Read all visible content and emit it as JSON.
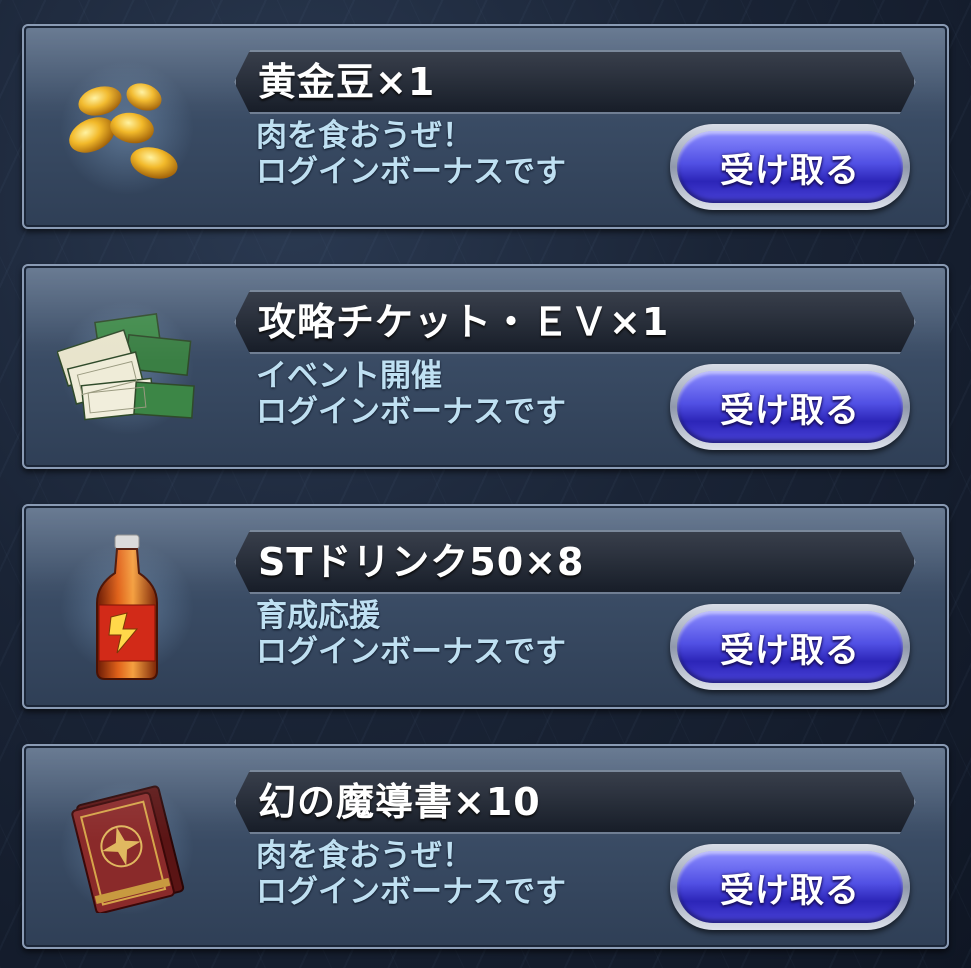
{
  "rewards": [
    {
      "title": "黄金豆×1",
      "line1": "肉を食おうぜ！",
      "line2": "ログインボーナスです",
      "button": "受け取る",
      "icon": "golden-beans-icon"
    },
    {
      "title": "攻略チケット・ＥＶ×1",
      "line1": "イベント開催",
      "line2": "ログインボーナスです",
      "button": "受け取る",
      "icon": "tickets-icon"
    },
    {
      "title": "STドリンク50×8",
      "line1": "育成応援",
      "line2": "ログインボーナスです",
      "button": "受け取る",
      "icon": "drink-bottle-icon"
    },
    {
      "title": "幻の魔導書×10",
      "line1": "肉を食おうぜ！",
      "line2": "ログインボーナスです",
      "button": "受け取る",
      "icon": "magic-book-icon"
    }
  ],
  "colors": {
    "button": "#5150e4",
    "description": "#bfe0f2",
    "title": "#ffffff"
  }
}
